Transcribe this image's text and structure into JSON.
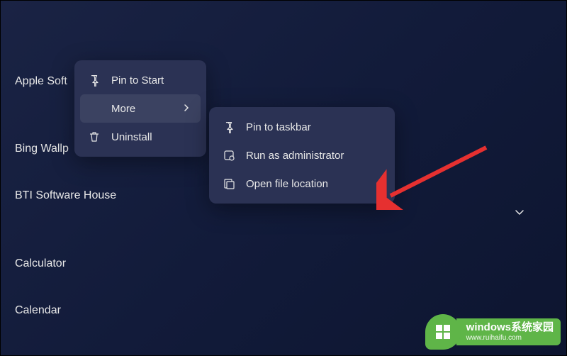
{
  "apps": {
    "item0": "Apple Soft",
    "item1": "Bing Wallp",
    "item2": "BTI Software House",
    "item3": "Calculator",
    "item4": "Calendar"
  },
  "menu1": {
    "pin_to_start": "Pin to Start",
    "more": "More",
    "uninstall": "Uninstall"
  },
  "menu2": {
    "pin_to_taskbar": "Pin to taskbar",
    "run_as_admin": "Run as administrator",
    "open_file_location": "Open file location"
  },
  "watermark": {
    "line1": "windows系统家园",
    "line2": "www.ruihaifu.com"
  }
}
